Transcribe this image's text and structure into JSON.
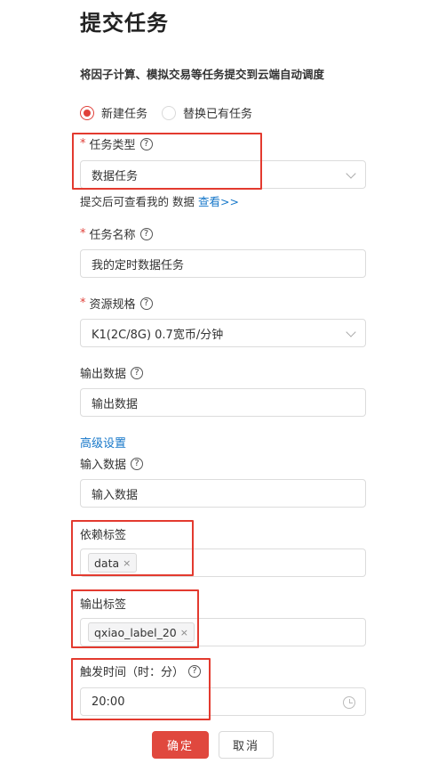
{
  "page": {
    "title": "提交任务",
    "subtitle": "将因子计算、模拟交易等任务提交到云端自动调度"
  },
  "mode": {
    "options": [
      "新建任务",
      "替换已有任务"
    ],
    "selected": "新建任务"
  },
  "required_mark": "*",
  "help_glyph": "?",
  "task_type": {
    "label": "任务类型",
    "value": "数据任务"
  },
  "hint": {
    "text": "提交后可查看我的 数据",
    "link": "查看>>"
  },
  "task_name": {
    "label": "任务名称",
    "value": "我的定时数据任务"
  },
  "resource": {
    "label": "资源规格",
    "value": "K1(2C/8G) 0.7宽币/分钟"
  },
  "output_data": {
    "label": "输出数据",
    "placeholder": "输出数据"
  },
  "advanced": {
    "label": "高级设置"
  },
  "input_data": {
    "label": "输入数据",
    "placeholder": "输入数据"
  },
  "depend_tags": {
    "label": "依赖标签",
    "tags": [
      "data"
    ]
  },
  "output_tags": {
    "label": "输出标签",
    "tags": [
      "qxiao_label_20"
    ]
  },
  "trigger_time": {
    "label": "触发时间（时：分）",
    "value": "20:00"
  },
  "tag_close_glyph": "×",
  "actions": {
    "confirm": "确定",
    "cancel": "取消"
  },
  "colors": {
    "accent": "#e0483e",
    "link": "#1677c9",
    "highlight_box": "#e33a2f"
  }
}
